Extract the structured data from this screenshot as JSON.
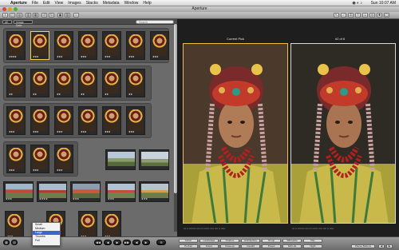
{
  "menubar": {
    "app_name": "Aperture",
    "items": [
      "File",
      "Edit",
      "View",
      "Images",
      "Stacks",
      "Metadata",
      "Window",
      "Help"
    ],
    "clock": "Sun 10:07 AM"
  },
  "window": {
    "title": "Aperture"
  },
  "toolbar": {
    "left_buttons": [
      "import-icon",
      "new-project-icon",
      "new-album-icon",
      "stack-icon",
      "unstack-icon",
      "rotate-left-icon",
      "rotate-right-icon",
      "compare-icon",
      "stack-mode-icon",
      "ranking-icon"
    ],
    "right_tools": [
      "select-icon",
      "straighten-icon",
      "crop-icon",
      "lift-icon",
      "stamp-icon",
      "redeye-icon",
      "spot-icon",
      "loupe-icon"
    ]
  },
  "browser": {
    "filter_chip": "All",
    "sort_chip": "Image Date",
    "search_placeholder": "Search",
    "rows": [
      {
        "kind": "stack",
        "thumbs": 7,
        "selected": 2,
        "ratings": [
          "★★★★",
          "★★★",
          "★★★",
          "★★★",
          "★★★",
          "★★★",
          "★★★"
        ]
      },
      {
        "kind": "stack",
        "thumbs": 6,
        "selected": 0,
        "ratings": [
          "★★",
          "★★",
          "★★",
          "★★",
          "★★",
          "★★"
        ]
      },
      {
        "kind": "stack",
        "thumbs": 6,
        "selected": 0,
        "ratings": [
          "★★★",
          "★★★",
          "★★★",
          "★★★",
          "★★★",
          "★★★"
        ]
      },
      {
        "kind": "mixed",
        "thumbs": 3,
        "selected": 0,
        "ratings": [
          "★★★",
          "★★★",
          "★★★"
        ],
        "wide": 2
      },
      {
        "kind": "wide",
        "thumbs": 5,
        "ratings": [
          "★★★",
          "★★★★",
          "★★★",
          "★★★",
          "★★★"
        ]
      },
      {
        "kind": "mixed",
        "thumbs": 4,
        "ratings": [
          "★★★",
          "★★★",
          "★★★",
          "★★★"
        ]
      }
    ]
  },
  "viewer": {
    "left_label": "Current Pick",
    "right_label": "#2 of 6"
  },
  "bottom": {
    "nav": [
      "◀◀",
      "◀",
      "▶",
      "▶▶",
      "◀",
      "▶"
    ],
    "zoom_menu": [
      "Small",
      "Medium",
      "Large",
      "Thumbs",
      "Full"
    ],
    "zoom_selected": 2,
    "keyword_buttons": [
      "Action",
      "Landscape",
      "Outdoor",
      "Architecture",
      "Group",
      "Silhouette",
      "Day",
      "Portrait",
      "Indoor",
      "Close-up",
      "Candid",
      "Posed",
      "Still Life",
      "Night",
      "Places"
    ],
    "keyword_field": "Places Buttons"
  },
  "colors": {
    "accent": "#f6d24a",
    "chrome": "#6b6b6b",
    "viewer_bg": "#1e1e1e"
  }
}
